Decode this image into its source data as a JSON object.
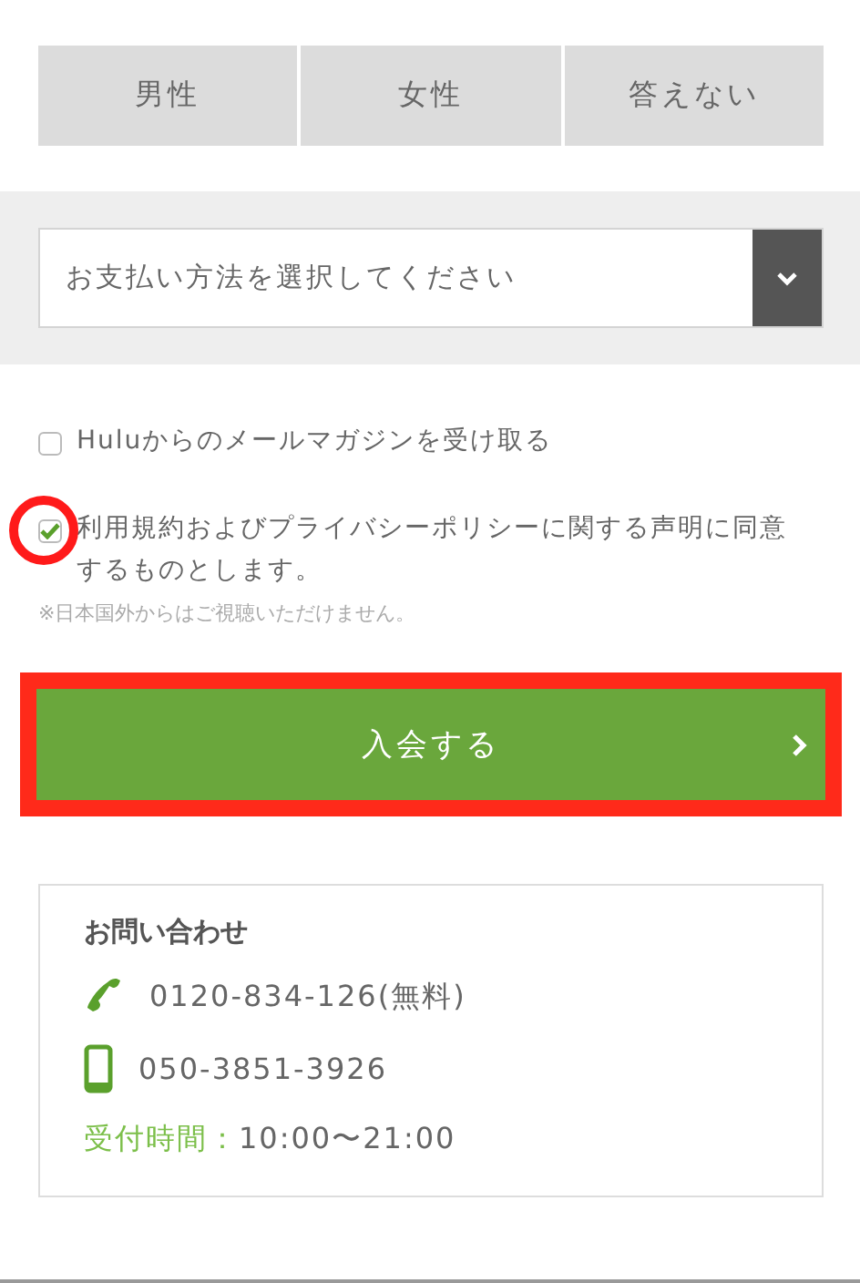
{
  "gender_options": [
    {
      "label": "男性",
      "selected": false
    },
    {
      "label": "女性",
      "selected": false
    },
    {
      "label": "答えない",
      "selected": false
    }
  ],
  "payment_select": {
    "value": "お支払い方法を選択してください"
  },
  "checkboxes": [
    {
      "label": "Huluからのメールマガジンを受け取る",
      "checked": false,
      "circled": false
    },
    {
      "label": "利用規約およびプライバシーポリシーに関する声明に同意するものとします。",
      "checked": true,
      "circled": true
    }
  ],
  "note": "※日本国外からはご視聴いただけません。",
  "submit_button": {
    "label": "入会する",
    "outlined": true
  },
  "contact": {
    "title": "お問い合わせ",
    "lines": [
      {
        "kind": "phone",
        "text": "0120-834-126(無料)"
      },
      {
        "kind": "mobile",
        "text": "050-3851-3926"
      }
    ],
    "hours_label": "受付時間：",
    "hours": "10:00〜21:00"
  }
}
